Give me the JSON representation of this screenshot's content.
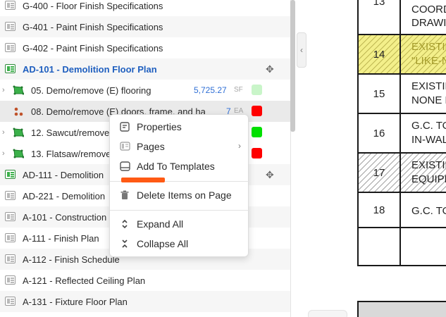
{
  "panel": {
    "rows": [
      {
        "label": "G-400 - Floor Finish Specifications"
      },
      {
        "label": "G-401 - Paint Finish Specifications"
      },
      {
        "label": "G-402 - Paint Finish Specifications"
      },
      {
        "label": "AD-101 - Demolition Floor Plan"
      },
      {
        "label": "05. Demo/remove (E) flooring",
        "qty": "5,725.27",
        "unit": "SF",
        "color": "#c9f5c9"
      },
      {
        "label": "08. Demo/remove (E) doors, frame, and ha",
        "qty": "7",
        "unit": "EA",
        "color": "#ff0000"
      },
      {
        "label": "12. Sawcut/remove",
        "color": "#00e000"
      },
      {
        "label": "13. Flatsaw/remove",
        "color": "#ff0000"
      },
      {
        "label": "AD-111 - Demolition"
      },
      {
        "label": "AD-221 - Demolition"
      },
      {
        "label": "A-101 - Construction"
      },
      {
        "label": "A-111 - Finish Plan"
      },
      {
        "label": "A-112 - Finish Schedule"
      },
      {
        "label": "A-121 - Reflected Ceiling Plan"
      },
      {
        "label": "A-131 - Fixture Floor Plan"
      }
    ]
  },
  "context_menu": {
    "items": [
      {
        "label": "Properties",
        "icon": "properties-icon"
      },
      {
        "label": "Pages",
        "icon": "pages-icon"
      },
      {
        "label": "Add To Templates",
        "icon": "template-icon"
      },
      {
        "label": "Delete Items on Page",
        "icon": "trash-icon"
      },
      {
        "label": "Expand All",
        "icon": "expand-icon"
      },
      {
        "label": "Collapse All",
        "icon": "collapse-icon"
      }
    ]
  },
  "drawing": {
    "rows": [
      {
        "num": "13",
        "text1": "COORD",
        "text2": "DRAWIN"
      },
      {
        "num": "14",
        "text1": "EXISTIN",
        "text2": "\"LIKE-N"
      },
      {
        "num": "15",
        "text1": "EXISTIN",
        "text2": "NONE E"
      },
      {
        "num": "16",
        "text1": "G.C. TO",
        "text2": "IN-WAL"
      },
      {
        "num": "17",
        "text1": "EXISTIN",
        "text2": "EQUIPM"
      },
      {
        "num": "18",
        "text1": "G.C. TO",
        "text2": ""
      }
    ]
  },
  "colors": {
    "accent_blue": "#1f5fbf",
    "quantity_blue": "#2f6fd6",
    "redaction_orange": "#ff5a14"
  }
}
